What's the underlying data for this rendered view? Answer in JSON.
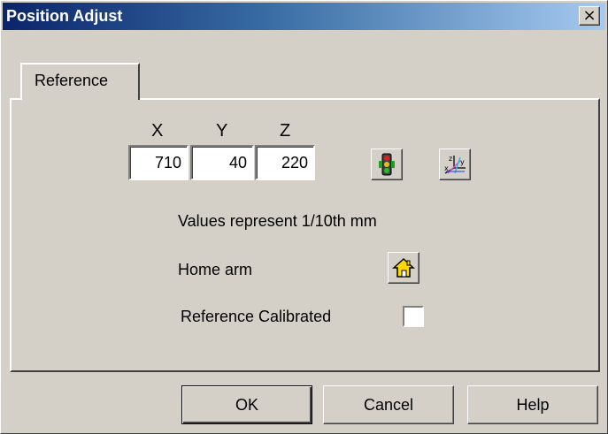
{
  "window": {
    "title": "Position Adjust",
    "close_glyph": "×"
  },
  "tabs": [
    {
      "label": "Reference",
      "active": true
    }
  ],
  "axes": {
    "x_label": "X",
    "y_label": "Y",
    "z_label": "Z",
    "x_value": "710",
    "y_value": "40",
    "z_value": "220"
  },
  "icons": {
    "traffic_light": "traffic-light-icon",
    "axes": "axes-icon",
    "home": "home-icon"
  },
  "info": {
    "units_text": "Values represent 1/10th mm",
    "home_label": "Home arm",
    "calibrated_label": "Reference Calibrated",
    "calibrated_checked": false
  },
  "buttons": {
    "ok": "OK",
    "cancel": "Cancel",
    "help": "Help"
  },
  "colors": {
    "title_start": "#0a246a",
    "title_end": "#a6caf0",
    "face": "#d4d0c8"
  }
}
